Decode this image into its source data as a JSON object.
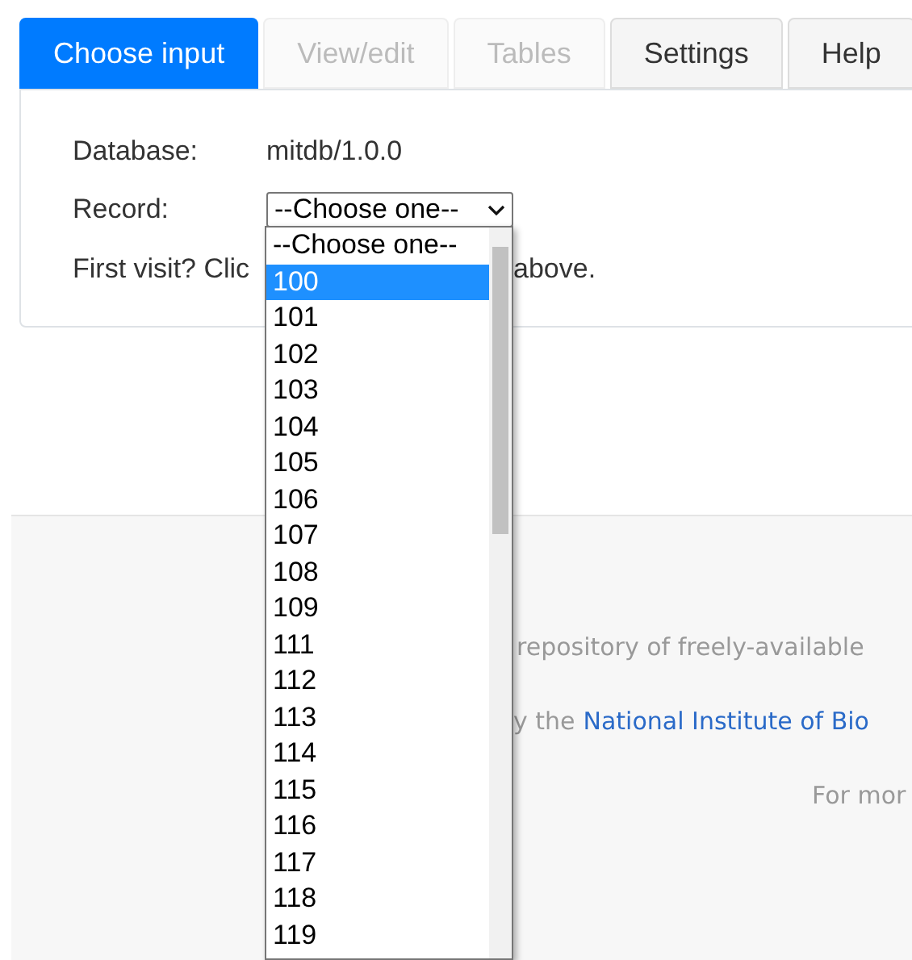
{
  "tabs": [
    {
      "label": "Choose input",
      "selected": true,
      "disabled": false
    },
    {
      "label": "View/edit",
      "selected": false,
      "disabled": true
    },
    {
      "label": "Tables",
      "selected": false,
      "disabled": true
    },
    {
      "label": "Settings",
      "selected": false,
      "disabled": false
    },
    {
      "label": "Help",
      "selected": false,
      "disabled": false
    }
  ],
  "form": {
    "database_label": "Database:",
    "database_value": "mitdb/1.0.0",
    "record_label": "Record:",
    "record_select": {
      "value": "--Choose one--",
      "expanded": true,
      "options": [
        {
          "label": "--Choose one--",
          "highlighted": false
        },
        {
          "label": "100",
          "highlighted": true
        },
        {
          "label": "101",
          "highlighted": false
        },
        {
          "label": "102",
          "highlighted": false
        },
        {
          "label": "103",
          "highlighted": false
        },
        {
          "label": "104",
          "highlighted": false
        },
        {
          "label": "105",
          "highlighted": false
        },
        {
          "label": "106",
          "highlighted": false
        },
        {
          "label": "107",
          "highlighted": false
        },
        {
          "label": "108",
          "highlighted": false
        },
        {
          "label": "109",
          "highlighted": false
        },
        {
          "label": "111",
          "highlighted": false
        },
        {
          "label": "112",
          "highlighted": false
        },
        {
          "label": "113",
          "highlighted": false
        },
        {
          "label": "114",
          "highlighted": false
        },
        {
          "label": "115",
          "highlighted": false
        },
        {
          "label": "116",
          "highlighted": false
        },
        {
          "label": "117",
          "highlighted": false
        },
        {
          "label": "118",
          "highlighted": false
        },
        {
          "label": "119",
          "highlighted": false
        }
      ]
    },
    "hint_start": "First visit? Clic",
    "hint_end": "above."
  },
  "footer": {
    "line_1": "repository of freely-available",
    "line_2_text": "y the",
    "line_2_link": "National Institute of Bio",
    "line_3": "For mor"
  }
}
